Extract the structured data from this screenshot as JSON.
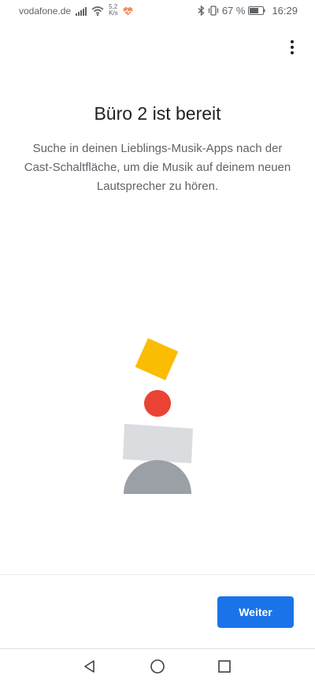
{
  "status_bar": {
    "carrier": "vodafone.de",
    "speed_value": "5,2",
    "speed_unit": "K/s",
    "battery_percent": "67 %",
    "time": "16:29",
    "icons": [
      "signal-icon",
      "wifi-icon",
      "health-icon",
      "bluetooth-icon",
      "vibrate-icon",
      "battery-icon"
    ]
  },
  "header": {
    "menu_icon": "more-vert-icon"
  },
  "main": {
    "title": "Büro 2 ist bereit",
    "description": "Suche in deinen Lieblings-Musik-Apps nach der Cast-Schaltfläche, um die Musik auf deinem neuen Lautsprecher zu hören."
  },
  "illustration": {
    "colors": {
      "square": "#FBBC04",
      "circle": "#EA4335",
      "block": "#DADCE0",
      "dome": "#9AA0A6"
    }
  },
  "footer": {
    "next_label": "Weiter",
    "accent": "#1A73E8"
  },
  "nav_bar": {
    "icons": [
      "back-icon",
      "home-icon",
      "recents-icon"
    ]
  }
}
